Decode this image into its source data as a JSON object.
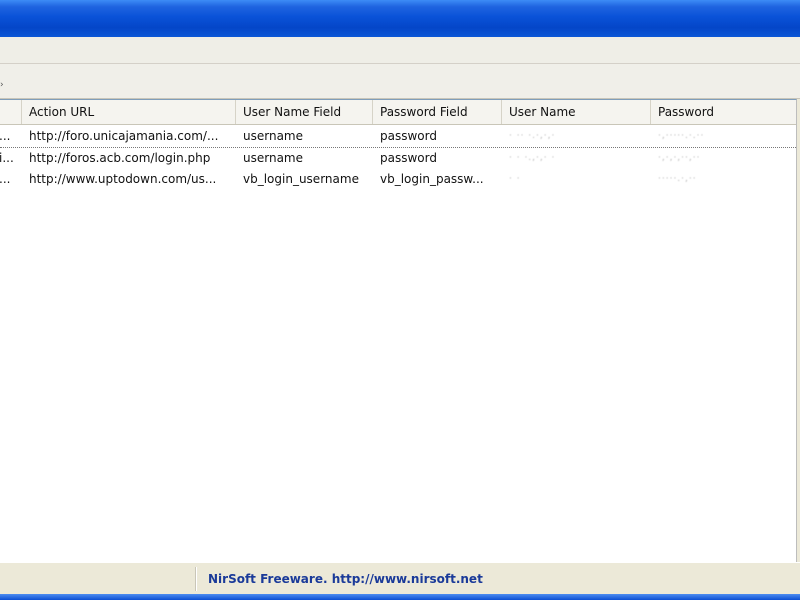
{
  "list": {
    "columns": [
      {
        "label": ""
      },
      {
        "label": "Action URL"
      },
      {
        "label": "User Name Field"
      },
      {
        "label": "Password Field"
      },
      {
        "label": "User Name"
      },
      {
        "label": "Password"
      }
    ],
    "rows": [
      {
        "c0": "...",
        "action_url": "http://foro.unicajamania.com/...",
        "user_field": "username",
        "pass_field": "password",
        "user_name": "· ·· ·.·,·,·",
        "password": "·,·····.·.··"
      },
      {
        "c0": "i...",
        "action_url": "http://foros.acb.com/login.php",
        "user_field": "username",
        "pass_field": "password",
        "user_name": "·  · ·.,·,· ·",
        "password": "·,·,·,··,··"
      },
      {
        "c0": "...",
        "action_url": "http://www.uptodown.com/us...",
        "user_field": "vb_login_username",
        "pass_field": "vb_login_passw...",
        "user_name": "· ·",
        "password": "·····.·,··"
      }
    ]
  },
  "status": {
    "text": "NirSoft Freeware.  http://www.nirsoft.net"
  },
  "colors": {
    "titlebar": "#0a52d8",
    "status_text": "#1a3a99"
  }
}
